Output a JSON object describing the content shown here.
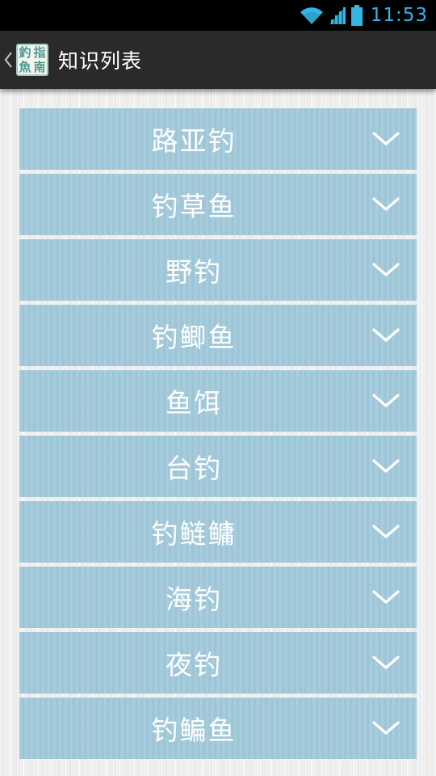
{
  "status_bar": {
    "time": "11:53",
    "wifi_icon": "wifi-icon",
    "signal_icon": "cell-signal-icon",
    "battery_icon": "battery-icon",
    "accent_color": "#33b5e5"
  },
  "action_bar": {
    "title": "知识列表",
    "up_icon": "chevron-left-icon",
    "logo": {
      "chars": [
        "釣",
        "指",
        "魚",
        "南"
      ],
      "color": "#4a9a9a"
    }
  },
  "topics": {
    "item_color": "#a2cadb",
    "expand_icon": "chevron-down-icon",
    "items": [
      {
        "label": "路亚钓"
      },
      {
        "label": "钓草鱼"
      },
      {
        "label": "野钓"
      },
      {
        "label": "钓鲫鱼"
      },
      {
        "label": "鱼饵"
      },
      {
        "label": "台钓"
      },
      {
        "label": "钓鲢鳙"
      },
      {
        "label": "海钓"
      },
      {
        "label": "夜钓"
      },
      {
        "label": "钓鳊鱼"
      }
    ]
  }
}
